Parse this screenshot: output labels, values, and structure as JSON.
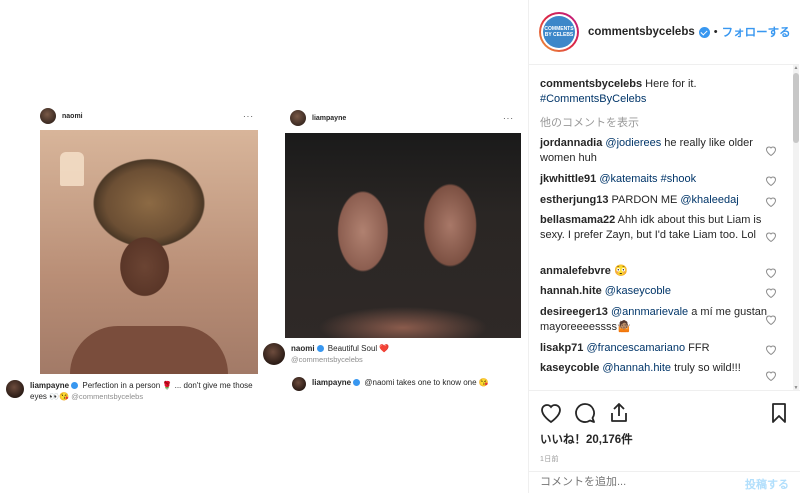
{
  "post": {
    "left_card": {
      "username": "naomi",
      "more": "···",
      "caption_user": "liampayne",
      "caption_text": "Perfection in a person 🌹 ... don't give me those eyes 👀😘",
      "caption_tag": "@commentsbycelebs"
    },
    "right_card": {
      "username": "liampayne",
      "more": "···",
      "caption_user": "naomi",
      "caption_text": "Beautiful Soul ❤️",
      "caption_tag": "@commentsbycelebs",
      "reply_user": "liampayne",
      "reply_text": "@naomi takes one to know one 😘"
    }
  },
  "panel": {
    "logo_text": "COMMENTS BY CELEBS",
    "username": "commentsbycelebs",
    "dot": "•",
    "follow_label": "フォローする",
    "caption_user": "commentsbycelebs",
    "caption_text": "Here for it.",
    "caption_hashtag": "#CommentsByCelebs",
    "more_comments": "他のコメントを表示",
    "comments": [
      {
        "user": "jordannadia",
        "mention": "@jodierees",
        "text": " he really like older women huh"
      },
      {
        "user": "jkwhittle91",
        "mention": "@katemaits",
        "text": " #shook"
      },
      {
        "user": "estherjung13",
        "mention": "",
        "text": "PARDON ME ",
        "mention2": "@khaleedaj"
      },
      {
        "user": "bellasmama22",
        "mention": "",
        "text": "Ahh idk about this but Liam is sexy. I prefer Zayn, but I'd take Liam too. Lol"
      },
      {
        "user": "anmalefebvre",
        "mention": "",
        "text": "😳"
      },
      {
        "user": "hannah.hite",
        "mention": "@kaseycoble",
        "text": ""
      },
      {
        "user": "desireeger13",
        "mention": "@annmarievale",
        "text": " a mí me gustan mayoreeeessss🤷🏽"
      },
      {
        "user": "lisakp71",
        "mention": "@francescamariano",
        "text": " FFR"
      },
      {
        "user": "kaseycoble",
        "mention": "@hannah.hite",
        "text": " truly so wild!!!"
      }
    ],
    "likes": "いいね！20,176件",
    "time_ago": "1日前",
    "add_comment_placeholder": "コメントを追加...",
    "post_label": "投稿する"
  }
}
